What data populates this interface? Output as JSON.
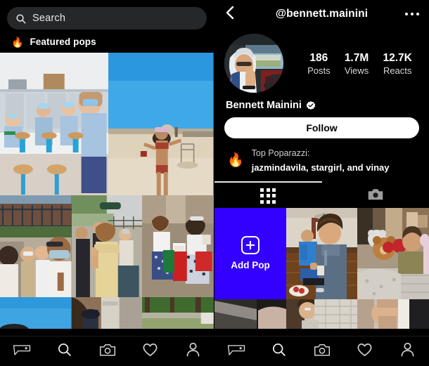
{
  "left_panel": {
    "search": {
      "placeholder_value": "Search",
      "icon": "search-icon"
    },
    "featured": {
      "icon": "fire-emoji",
      "emoji": "🔥",
      "label": "Featured pops"
    },
    "grid": {
      "row1": [
        {
          "name": "photo-classroom-masks",
          "alt": "Students in blue uniforms with masks at lab counter"
        },
        {
          "name": "photo-beach-bikini",
          "alt": "Woman on sandy beach under blue sky"
        }
      ],
      "row2": [
        {
          "name": "photo-group-outdoor-masks",
          "alt": "Group of friends outdoors wearing masks"
        },
        {
          "name": "photo-two-friends-thumbsup",
          "alt": "Two friends giving thumbs up outdoors"
        },
        {
          "name": "photo-girls-shopping-bags",
          "alt": "Girls holding shopping bags and phones"
        }
      ],
      "row3": [
        {
          "name": "photo-blue-sky",
          "alt": "Blue sky"
        },
        {
          "name": "photo-woman-walkway",
          "alt": "Woman walking on paved path"
        },
        {
          "name": "photo-park-trees",
          "alt": "Park with tall trees and fence"
        }
      ]
    }
  },
  "right_panel": {
    "header": {
      "back_icon": "chevron-left-icon",
      "handle": "@bennett.mainini",
      "menu_icon": "more-options-icon"
    },
    "profile": {
      "avatar": {
        "name": "avatar",
        "alt": "Person in white hoodie inside a car waving"
      },
      "display_name": "Bennett Mainini",
      "verified": true,
      "verified_icon": "verified-badge-icon",
      "stats": [
        {
          "value": "186",
          "label": "Posts"
        },
        {
          "value": "1.7M",
          "label": "Views"
        },
        {
          "value": "12.7K",
          "label": "Reacts"
        }
      ],
      "follow_label": "Follow",
      "top_poparazzi": {
        "icon": "fire-emoji",
        "emoji": "🔥",
        "title": "Top Poparazzi:",
        "names": "jazmindavila, stargirl, and vinay"
      }
    },
    "tabs": [
      {
        "name": "grid-tab",
        "icon": "grid-icon",
        "active": true
      },
      {
        "name": "camera-tab",
        "icon": "camera-icon",
        "active": false
      }
    ],
    "grid": {
      "row1": [
        {
          "name": "add-pop-tile",
          "label": "Add Pop",
          "icon": "plus-square-icon",
          "color": "#3300ff"
        },
        {
          "name": "photo-teen-at-table",
          "alt": "Teen sitting at dining table with man behind"
        },
        {
          "name": "photo-person-stuffed-animals",
          "alt": "Person lying in bed with stuffed animals"
        }
      ],
      "row2": [
        {
          "name": "photo-dark-surface",
          "alt": "Dark surface close-up"
        },
        {
          "name": "photo-person-lying-bed",
          "alt": "Person lying on patterned bedding"
        },
        {
          "name": "photo-person-reclined",
          "alt": "Person reclined indoors"
        }
      ]
    }
  },
  "bottom_nav": {
    "items": [
      {
        "name": "nav-home",
        "icon": "poparazzi-logo-icon"
      },
      {
        "name": "nav-search",
        "icon": "search-icon"
      },
      {
        "name": "nav-camera",
        "icon": "camera-icon"
      },
      {
        "name": "nav-activity",
        "icon": "heart-icon"
      },
      {
        "name": "nav-profile",
        "icon": "person-icon"
      }
    ]
  },
  "theme": {
    "background": "#000000",
    "search_field": "#262729",
    "accent_blue": "#3300ff",
    "text_primary": "#ffffff",
    "text_secondary": "#cfcfcf"
  }
}
